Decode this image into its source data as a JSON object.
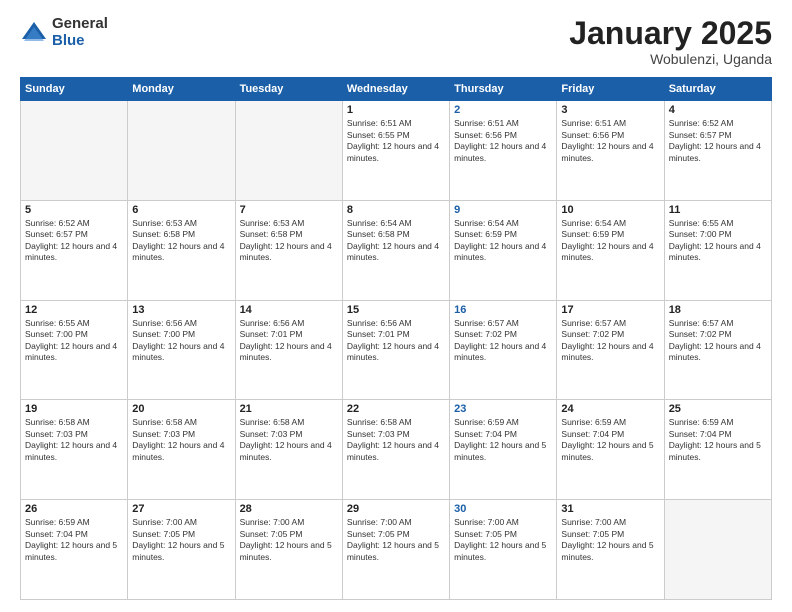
{
  "logo": {
    "general": "General",
    "blue": "Blue"
  },
  "header": {
    "month": "January 2025",
    "location": "Wobulenzi, Uganda"
  },
  "weekdays": [
    "Sunday",
    "Monday",
    "Tuesday",
    "Wednesday",
    "Thursday",
    "Friday",
    "Saturday"
  ],
  "weeks": [
    [
      {
        "day": "",
        "empty": true
      },
      {
        "day": "",
        "empty": true
      },
      {
        "day": "",
        "empty": true
      },
      {
        "day": "1",
        "sunrise": "6:51 AM",
        "sunset": "6:55 PM",
        "daylight": "12 hours and 4 minutes."
      },
      {
        "day": "2",
        "sunrise": "6:51 AM",
        "sunset": "6:56 PM",
        "daylight": "12 hours and 4 minutes.",
        "thursday": true
      },
      {
        "day": "3",
        "sunrise": "6:51 AM",
        "sunset": "6:56 PM",
        "daylight": "12 hours and 4 minutes."
      },
      {
        "day": "4",
        "sunrise": "6:52 AM",
        "sunset": "6:57 PM",
        "daylight": "12 hours and 4 minutes."
      }
    ],
    [
      {
        "day": "5",
        "sunrise": "6:52 AM",
        "sunset": "6:57 PM",
        "daylight": "12 hours and 4 minutes."
      },
      {
        "day": "6",
        "sunrise": "6:53 AM",
        "sunset": "6:58 PM",
        "daylight": "12 hours and 4 minutes."
      },
      {
        "day": "7",
        "sunrise": "6:53 AM",
        "sunset": "6:58 PM",
        "daylight": "12 hours and 4 minutes."
      },
      {
        "day": "8",
        "sunrise": "6:54 AM",
        "sunset": "6:58 PM",
        "daylight": "12 hours and 4 minutes."
      },
      {
        "day": "9",
        "sunrise": "6:54 AM",
        "sunset": "6:59 PM",
        "daylight": "12 hours and 4 minutes.",
        "thursday": true
      },
      {
        "day": "10",
        "sunrise": "6:54 AM",
        "sunset": "6:59 PM",
        "daylight": "12 hours and 4 minutes."
      },
      {
        "day": "11",
        "sunrise": "6:55 AM",
        "sunset": "7:00 PM",
        "daylight": "12 hours and 4 minutes."
      }
    ],
    [
      {
        "day": "12",
        "sunrise": "6:55 AM",
        "sunset": "7:00 PM",
        "daylight": "12 hours and 4 minutes."
      },
      {
        "day": "13",
        "sunrise": "6:56 AM",
        "sunset": "7:00 PM",
        "daylight": "12 hours and 4 minutes."
      },
      {
        "day": "14",
        "sunrise": "6:56 AM",
        "sunset": "7:01 PM",
        "daylight": "12 hours and 4 minutes."
      },
      {
        "day": "15",
        "sunrise": "6:56 AM",
        "sunset": "7:01 PM",
        "daylight": "12 hours and 4 minutes."
      },
      {
        "day": "16",
        "sunrise": "6:57 AM",
        "sunset": "7:02 PM",
        "daylight": "12 hours and 4 minutes.",
        "thursday": true
      },
      {
        "day": "17",
        "sunrise": "6:57 AM",
        "sunset": "7:02 PM",
        "daylight": "12 hours and 4 minutes."
      },
      {
        "day": "18",
        "sunrise": "6:57 AM",
        "sunset": "7:02 PM",
        "daylight": "12 hours and 4 minutes."
      }
    ],
    [
      {
        "day": "19",
        "sunrise": "6:58 AM",
        "sunset": "7:03 PM",
        "daylight": "12 hours and 4 minutes."
      },
      {
        "day": "20",
        "sunrise": "6:58 AM",
        "sunset": "7:03 PM",
        "daylight": "12 hours and 4 minutes."
      },
      {
        "day": "21",
        "sunrise": "6:58 AM",
        "sunset": "7:03 PM",
        "daylight": "12 hours and 4 minutes."
      },
      {
        "day": "22",
        "sunrise": "6:58 AM",
        "sunset": "7:03 PM",
        "daylight": "12 hours and 4 minutes."
      },
      {
        "day": "23",
        "sunrise": "6:59 AM",
        "sunset": "7:04 PM",
        "daylight": "12 hours and 5 minutes.",
        "thursday": true
      },
      {
        "day": "24",
        "sunrise": "6:59 AM",
        "sunset": "7:04 PM",
        "daylight": "12 hours and 5 minutes."
      },
      {
        "day": "25",
        "sunrise": "6:59 AM",
        "sunset": "7:04 PM",
        "daylight": "12 hours and 5 minutes."
      }
    ],
    [
      {
        "day": "26",
        "sunrise": "6:59 AM",
        "sunset": "7:04 PM",
        "daylight": "12 hours and 5 minutes."
      },
      {
        "day": "27",
        "sunrise": "7:00 AM",
        "sunset": "7:05 PM",
        "daylight": "12 hours and 5 minutes."
      },
      {
        "day": "28",
        "sunrise": "7:00 AM",
        "sunset": "7:05 PM",
        "daylight": "12 hours and 5 minutes."
      },
      {
        "day": "29",
        "sunrise": "7:00 AM",
        "sunset": "7:05 PM",
        "daylight": "12 hours and 5 minutes."
      },
      {
        "day": "30",
        "sunrise": "7:00 AM",
        "sunset": "7:05 PM",
        "daylight": "12 hours and 5 minutes.",
        "thursday": true
      },
      {
        "day": "31",
        "sunrise": "7:00 AM",
        "sunset": "7:05 PM",
        "daylight": "12 hours and 5 minutes."
      },
      {
        "day": "",
        "empty": true
      }
    ]
  ]
}
